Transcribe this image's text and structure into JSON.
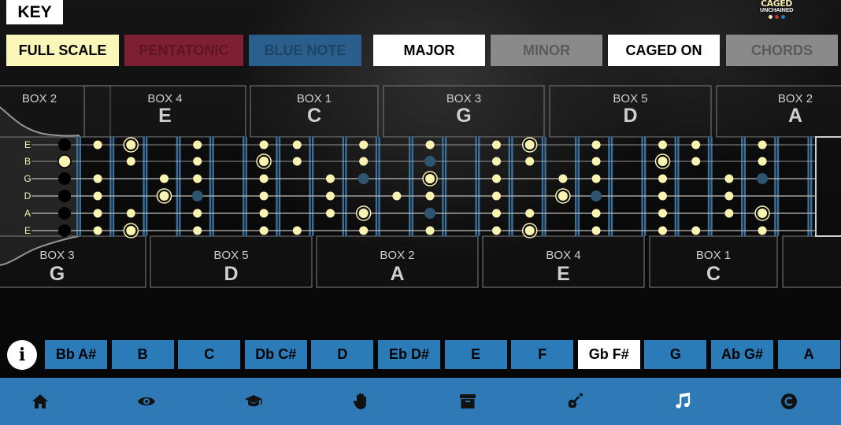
{
  "key_label": "KEY",
  "logo": {
    "line1": "CAGED",
    "line2": "UNCHAINED",
    "dot_colors": [
      "#f2e6b8",
      "#c0392b",
      "#2b7bb9"
    ]
  },
  "scale_modes": [
    {
      "label": "FULL SCALE",
      "state": "active",
      "bg": "#fbf7b8",
      "fg": "#000000"
    },
    {
      "label": "PENTATONIC",
      "state": "inactive",
      "bg": "#7e1f33",
      "fg": "#5e1424"
    },
    {
      "label": "BLUE NOTE",
      "state": "inactive",
      "bg": "#2a5f8c",
      "fg": "#1d4366"
    }
  ],
  "tonality": [
    {
      "label": "MAJOR",
      "state": "active",
      "bg": "#ffffff",
      "fg": "#000000"
    },
    {
      "label": "MINOR",
      "state": "inactive",
      "bg": "#8a8a8a",
      "fg": "#5a5a5a"
    }
  ],
  "overlays": [
    {
      "label": "CAGED ON",
      "state": "active",
      "bg": "#ffffff",
      "fg": "#000000"
    },
    {
      "label": "CHORDS",
      "state": "inactive",
      "bg": "#8a8a8a",
      "fg": "#5a5a5a"
    }
  ],
  "top_boxes": [
    {
      "box": "BOX 2",
      "chord": ""
    },
    {
      "box": "BOX 4",
      "chord": "E"
    },
    {
      "box": "BOX 1",
      "chord": "C"
    },
    {
      "box": "BOX 3",
      "chord": "G"
    },
    {
      "box": "BOX 5",
      "chord": "D"
    },
    {
      "box": "BOX 2",
      "chord": "A"
    }
  ],
  "bottom_boxes": [
    {
      "box": "BOX 3",
      "chord": "G"
    },
    {
      "box": "BOX 5",
      "chord": "D"
    },
    {
      "box": "BOX 2",
      "chord": "A"
    },
    {
      "box": "BOX 4",
      "chord": "E"
    },
    {
      "box": "BOX 1",
      "chord": "C"
    },
    {
      "box": "",
      "chord": ""
    }
  ],
  "strings": [
    "E",
    "B",
    "G",
    "D",
    "A",
    "E"
  ],
  "key_buttons": [
    {
      "label": "Bb A#",
      "selected": false
    },
    {
      "label": "B",
      "selected": false
    },
    {
      "label": "C",
      "selected": false
    },
    {
      "label": "Db C#",
      "selected": false
    },
    {
      "label": "D",
      "selected": false
    },
    {
      "label": "Eb D#",
      "selected": false
    },
    {
      "label": "E",
      "selected": false
    },
    {
      "label": "F",
      "selected": false
    },
    {
      "label": "Gb F#",
      "selected": true
    },
    {
      "label": "G",
      "selected": false
    },
    {
      "label": "Ab G#",
      "selected": false
    },
    {
      "label": "A",
      "selected": false
    }
  ],
  "info_button": "i",
  "nav_items": [
    {
      "name": "home-icon"
    },
    {
      "name": "eye-icon"
    },
    {
      "name": "graduation-cap-icon"
    },
    {
      "name": "hand-icon"
    },
    {
      "name": "archive-box-icon"
    },
    {
      "name": "guitar-icon"
    },
    {
      "name": "music-note-icon"
    },
    {
      "name": "copyright-c-icon"
    }
  ],
  "colors": {
    "accent_blue": "#2b7bb9",
    "note_fill": "#fbf3b0",
    "fret_blue": "#3a6f9c",
    "ghost_note": "#2e5570"
  }
}
